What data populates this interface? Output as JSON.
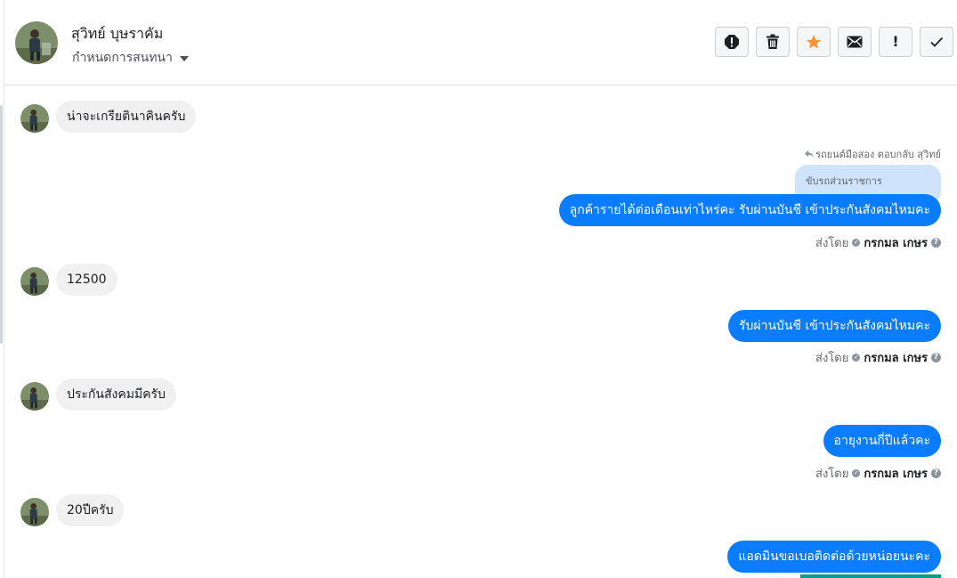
{
  "conversation": {
    "contact_name": "สุวิทย์ บุษราคัม",
    "assign_label": "กำหนดการสนทนา"
  },
  "toolbar": {
    "actions": [
      "report-icon",
      "trash-icon",
      "star-icon",
      "envelope-icon",
      "exclamation-icon",
      "check-icon"
    ],
    "exclamation_text": "!"
  },
  "colors": {
    "outgoing_bubble": "#0a7cff",
    "incoming_bubble": "#f0f0f0",
    "quoted_bubble": "#cfe3fb",
    "star": "#f7923a"
  },
  "messages": {
    "m1": "น่าจะเกรียตินาคินครับ",
    "reply_context": "รถยนต์มือสอง ตอบกลับ สุวิทย์",
    "quoted_text": "ขับรถส่วนราชการ",
    "m2": "ลูกค้ารายได้ต่อเดือนเท่าไหร่คะ รับผ่านบันชี เข้าประกันสังคมไหมคะ",
    "m3": "12500",
    "m4": "รับผ่านบันชี เข้าประกันสังคมไหมคะ",
    "m5": "ประกันสังคมมีครับ",
    "m6": "อายุงานกี่ปีแล้วคะ",
    "m7": "20ปีครับ",
    "m8": "แอดมินขอเบอติดต่อด้วยหน่อยนะคะ"
  },
  "sent_by": {
    "label": "ส่งโดย",
    "agent": "กรกมล เกษร",
    "help": "?"
  }
}
